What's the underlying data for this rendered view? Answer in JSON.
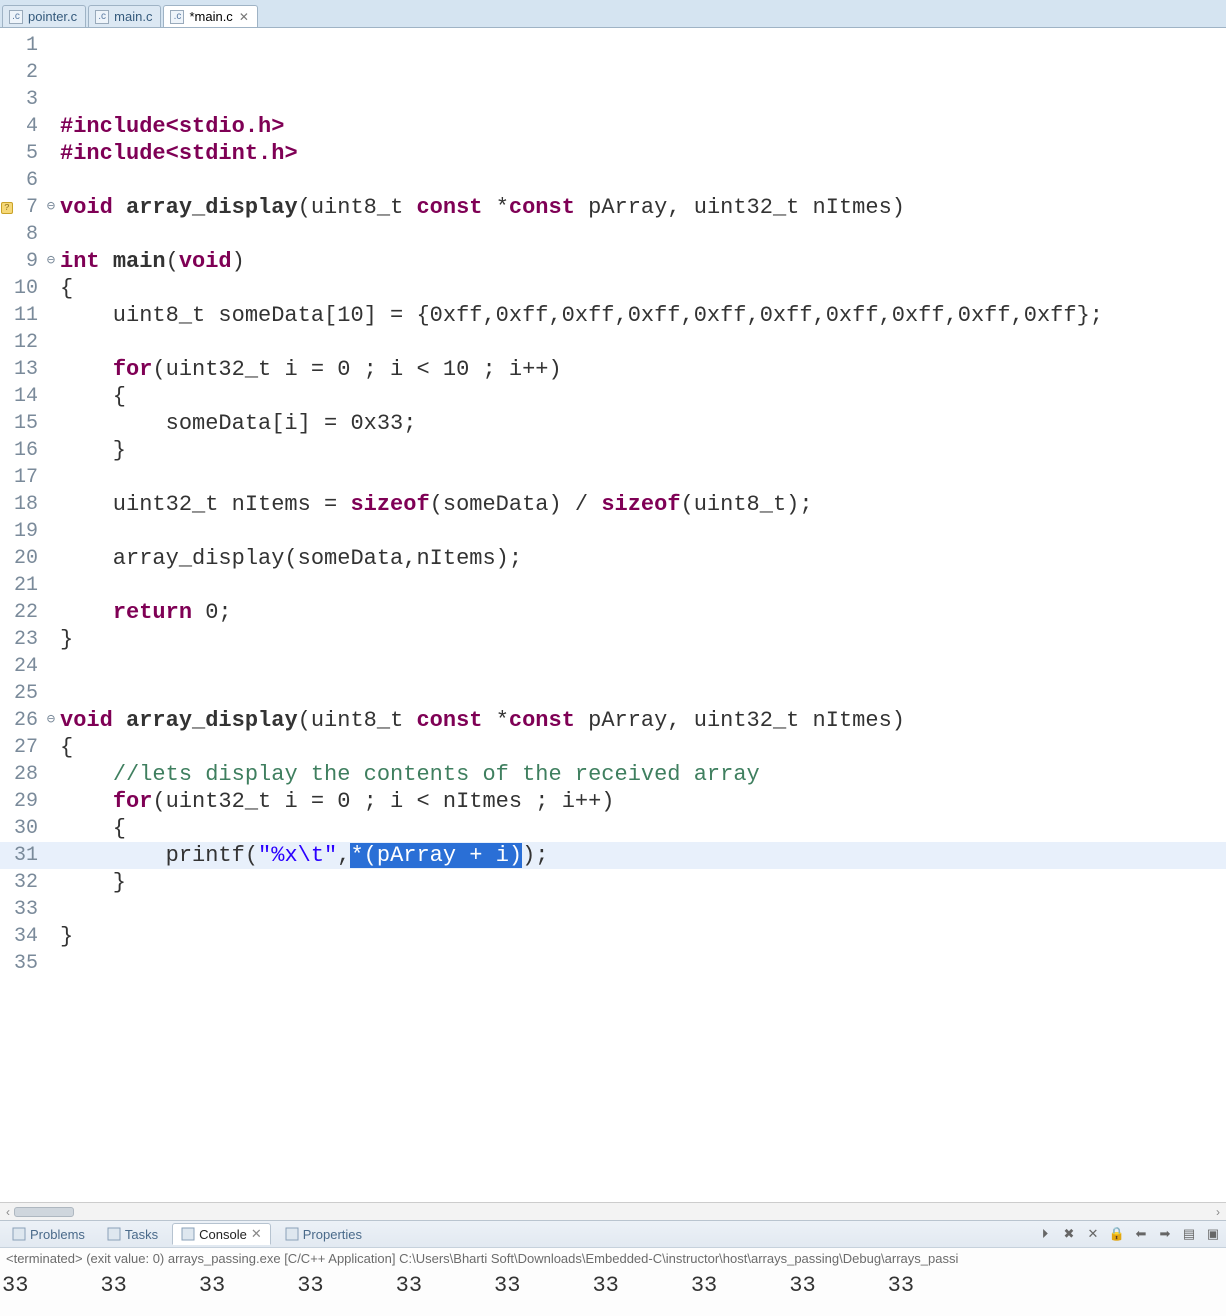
{
  "tabs": [
    {
      "label": "pointer.c",
      "active": false,
      "dirty": false,
      "closable": false
    },
    {
      "label": "main.c",
      "active": false,
      "dirty": false,
      "closable": false
    },
    {
      "label": "*main.c",
      "active": true,
      "dirty": true,
      "closable": true
    }
  ],
  "editor": {
    "highlighted_line": 31,
    "lines": [
      {
        "n": 1,
        "marker": "",
        "fold": "",
        "tokens": []
      },
      {
        "n": 2,
        "marker": "",
        "fold": "",
        "tokens": []
      },
      {
        "n": 3,
        "marker": "",
        "fold": "",
        "tokens": []
      },
      {
        "n": 4,
        "marker": "",
        "fold": "",
        "tokens": [
          {
            "t": "#include",
            "c": "pp"
          },
          {
            "t": "<stdio.h>",
            "c": "kw"
          }
        ]
      },
      {
        "n": 5,
        "marker": "",
        "fold": "",
        "tokens": [
          {
            "t": "#include",
            "c": "pp"
          },
          {
            "t": "<stdint.h>",
            "c": "kw"
          }
        ]
      },
      {
        "n": 6,
        "marker": "",
        "fold": "",
        "tokens": []
      },
      {
        "n": 7,
        "marker": "warning",
        "fold": "⊖",
        "tokens": [
          {
            "t": "void",
            "c": "kw"
          },
          {
            "t": " "
          },
          {
            "t": "array_display",
            "c": "",
            "b": true
          },
          {
            "t": "(uint8_t "
          },
          {
            "t": "const",
            "c": "kw"
          },
          {
            "t": " *"
          },
          {
            "t": "const",
            "c": "kw"
          },
          {
            "t": " pArray, uint32_t nItmes)"
          }
        ]
      },
      {
        "n": 8,
        "marker": "",
        "fold": "",
        "tokens": []
      },
      {
        "n": 9,
        "marker": "",
        "fold": "⊖",
        "tokens": [
          {
            "t": "int",
            "c": "kw"
          },
          {
            "t": " "
          },
          {
            "t": "main",
            "c": "",
            "b": true
          },
          {
            "t": "("
          },
          {
            "t": "void",
            "c": "kw"
          },
          {
            "t": ")"
          }
        ]
      },
      {
        "n": 10,
        "marker": "",
        "fold": "",
        "tokens": [
          {
            "t": "{"
          }
        ]
      },
      {
        "n": 11,
        "marker": "",
        "fold": "",
        "tokens": [
          {
            "t": "    uint8_t someData[10] = {0xff,0xff,0xff,0xff,0xff,0xff,0xff,0xff,0xff,0xff};"
          }
        ]
      },
      {
        "n": 12,
        "marker": "",
        "fold": "",
        "tokens": []
      },
      {
        "n": 13,
        "marker": "",
        "fold": "",
        "tokens": [
          {
            "t": "    "
          },
          {
            "t": "for",
            "c": "kw"
          },
          {
            "t": "(uint32_t i = 0 ; i < 10 ; i++)"
          }
        ]
      },
      {
        "n": 14,
        "marker": "",
        "fold": "",
        "tokens": [
          {
            "t": "    {"
          }
        ]
      },
      {
        "n": 15,
        "marker": "",
        "fold": "",
        "tokens": [
          {
            "t": "        someData[i] = 0x33;"
          }
        ]
      },
      {
        "n": 16,
        "marker": "",
        "fold": "",
        "tokens": [
          {
            "t": "    }"
          }
        ]
      },
      {
        "n": 17,
        "marker": "",
        "fold": "",
        "tokens": []
      },
      {
        "n": 18,
        "marker": "",
        "fold": "",
        "tokens": [
          {
            "t": "    uint32_t nItems = "
          },
          {
            "t": "sizeof",
            "c": "kw"
          },
          {
            "t": "(someData) / "
          },
          {
            "t": "sizeof",
            "c": "kw"
          },
          {
            "t": "(uint8_t);"
          }
        ]
      },
      {
        "n": 19,
        "marker": "",
        "fold": "",
        "tokens": []
      },
      {
        "n": 20,
        "marker": "",
        "fold": "",
        "tokens": [
          {
            "t": "    array_display(someData,nItems);"
          }
        ]
      },
      {
        "n": 21,
        "marker": "",
        "fold": "",
        "tokens": []
      },
      {
        "n": 22,
        "marker": "",
        "fold": "",
        "tokens": [
          {
            "t": "    "
          },
          {
            "t": "return",
            "c": "kw"
          },
          {
            "t": " 0;"
          }
        ]
      },
      {
        "n": 23,
        "marker": "",
        "fold": "",
        "tokens": [
          {
            "t": "}"
          }
        ]
      },
      {
        "n": 24,
        "marker": "",
        "fold": "",
        "tokens": []
      },
      {
        "n": 25,
        "marker": "",
        "fold": "",
        "tokens": []
      },
      {
        "n": 26,
        "marker": "",
        "fold": "⊖",
        "tokens": [
          {
            "t": "void",
            "c": "kw"
          },
          {
            "t": " "
          },
          {
            "t": "array_display",
            "c": "",
            "b": true
          },
          {
            "t": "(uint8_t "
          },
          {
            "t": "const",
            "c": "kw"
          },
          {
            "t": " *"
          },
          {
            "t": "const",
            "c": "kw"
          },
          {
            "t": " pArray, uint32_t nItmes)"
          }
        ]
      },
      {
        "n": 27,
        "marker": "",
        "fold": "",
        "tokens": [
          {
            "t": "{"
          }
        ]
      },
      {
        "n": 28,
        "marker": "",
        "fold": "",
        "tokens": [
          {
            "t": "    "
          },
          {
            "t": "//lets display the contents of the received array",
            "c": "cmt"
          }
        ]
      },
      {
        "n": 29,
        "marker": "",
        "fold": "",
        "tokens": [
          {
            "t": "    "
          },
          {
            "t": "for",
            "c": "kw"
          },
          {
            "t": "(uint32_t i = 0 ; i < nItmes ; i++)"
          }
        ]
      },
      {
        "n": 30,
        "marker": "",
        "fold": "",
        "tokens": [
          {
            "t": "    {"
          }
        ]
      },
      {
        "n": 31,
        "marker": "",
        "fold": "",
        "tokens": [
          {
            "t": "        printf("
          },
          {
            "t": "\"%x\\t\"",
            "c": "str"
          },
          {
            "t": ","
          },
          {
            "t": "*(pArray + i)",
            "c": "sel"
          },
          {
            "t": ");"
          }
        ]
      },
      {
        "n": 32,
        "marker": "",
        "fold": "",
        "tokens": [
          {
            "t": "    }"
          }
        ]
      },
      {
        "n": 33,
        "marker": "",
        "fold": "",
        "tokens": []
      },
      {
        "n": 34,
        "marker": "",
        "fold": "",
        "tokens": [
          {
            "t": "}"
          }
        ]
      },
      {
        "n": 35,
        "marker": "",
        "fold": "",
        "tokens": []
      }
    ]
  },
  "bottom_tabs": [
    {
      "label": "Problems",
      "icon": "problems-icon",
      "active": false
    },
    {
      "label": "Tasks",
      "icon": "tasks-icon",
      "active": false
    },
    {
      "label": "Console",
      "icon": "console-icon",
      "active": true,
      "closable": true
    },
    {
      "label": "Properties",
      "icon": "properties-icon",
      "active": false
    }
  ],
  "console_toolbar": [
    "pin-icon",
    "remove-all-icon",
    "remove-icon",
    "scroll-lock-icon",
    "prev-icon",
    "next-icon",
    "display-icon",
    "terminal-icon"
  ],
  "console": {
    "header": "<terminated> (exit value: 0) arrays_passing.exe [C/C++ Application] C:\\Users\\Bharti Soft\\Downloads\\Embedded-C\\instructor\\host\\arrays_passing\\Debug\\arrays_passi",
    "output": [
      "33",
      "33",
      "33",
      "33",
      "33",
      "33",
      "33",
      "33",
      "33",
      "33"
    ]
  }
}
